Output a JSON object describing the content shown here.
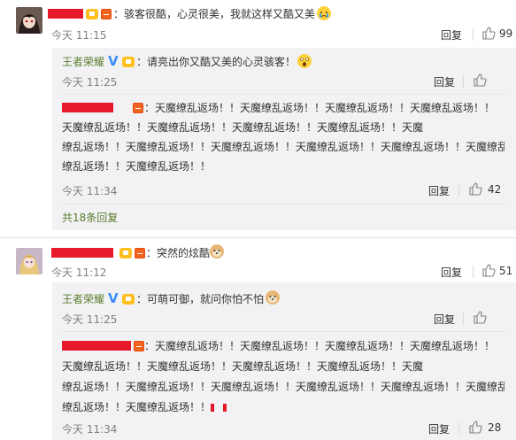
{
  "colors": {
    "brand_link": "#5b7d2c",
    "subcomment_bg": "#f2f2f5",
    "redaction": "#e8192c",
    "verified_v": "#3a8ef6"
  },
  "comments": [
    {
      "text": "：骇客很酷，心灵很美，我就这样又酷又美",
      "time": "今天 11:15",
      "reply_label": "回复",
      "likes": "99",
      "replies": [
        {
          "author": "王者荣耀",
          "text": "：请亮出你又酷又美的心灵骇客！",
          "time": "今天 11:25",
          "reply_label": "回复"
        },
        {
          "lines": [
            "：天魔缭乱返场！！天魔缭乱返场！！天魔缭乱返场！！天魔缭乱返场！！",
            "天魔缭乱返场！！天魔缭乱返场！！天魔缭乱返场！！天魔缭乱返场！！天魔",
            "缭乱返场！！天魔缭乱返场！！天魔缭乱返场！！天魔缭乱返场！！天魔缭乱返场！！天魔缭乱返场！！天魔",
            "缭乱返场！！天魔缭乱返场！！"
          ],
          "time": "今天 11:34",
          "reply_label": "回复",
          "likes": "42"
        }
      ],
      "more_replies": "共18条回复"
    },
    {
      "text": "：突然的炫酷",
      "time": "今天 11:12",
      "reply_label": "回复",
      "likes": "51",
      "replies": [
        {
          "author": "王者荣耀",
          "text": "：可萌可御，就问你怕不怕",
          "time": "今天 11:25",
          "reply_label": "回复"
        },
        {
          "lines": [
            "：天魔缭乱返场！！天魔缭乱返场！！天魔缭乱返场！！天魔缭乱返场！！",
            "天魔缭乱返场！！天魔缭乱返场！！天魔缭乱返场！！天魔缭乱返场！！天魔",
            "缭乱返场！！天魔缭乱返场！！天魔缭乱返场！！天魔缭乱返场！！天魔缭乱返场！！天魔缭乱返场！！天魔",
            "缭乱返场！！天魔缭乱返场！！"
          ],
          "time": "今天 11:34",
          "reply_label": "回复",
          "likes": "28"
        }
      ]
    }
  ]
}
